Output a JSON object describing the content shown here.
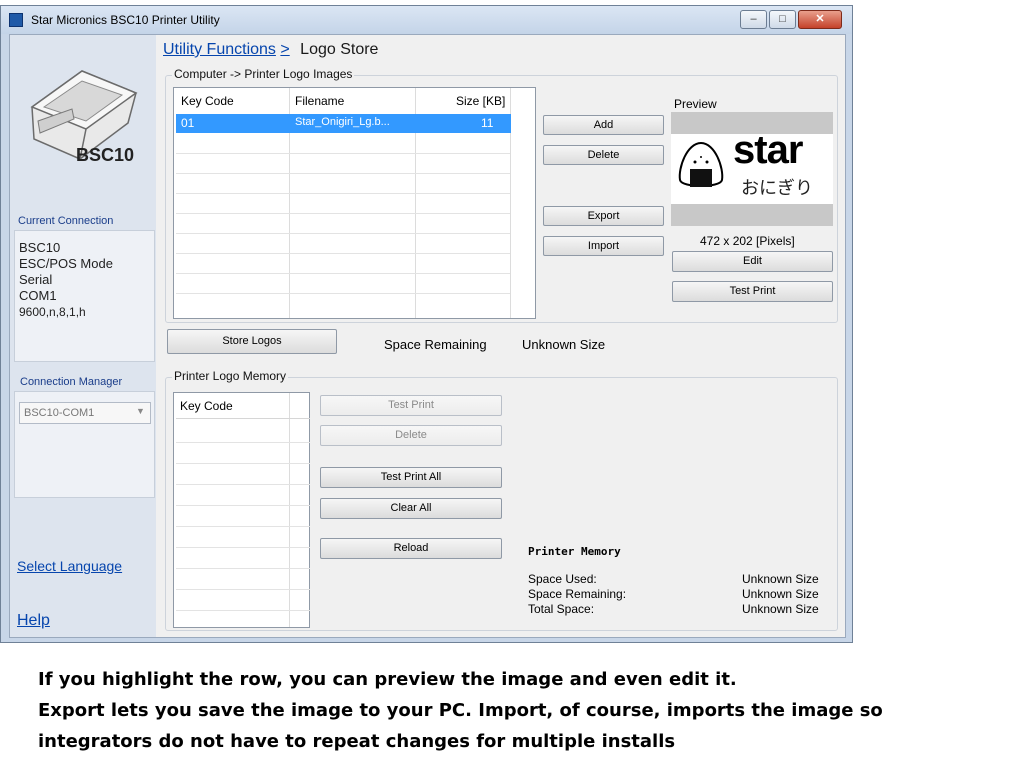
{
  "window": {
    "title": "Star Micronics BSC10 Printer Utility",
    "controls": [
      "–",
      "□",
      "✕"
    ]
  },
  "sidebar": {
    "printer_model": "BSC10",
    "current_connection_label": "Current Connection",
    "connection_lines": [
      "BSC10",
      "ESC/POS Mode",
      "Serial",
      "COM1",
      "9600,n,8,1,h"
    ],
    "connection_manager_label": "Connection Manager",
    "connection_selected": "BSC10-COM1",
    "select_language": "Select Language",
    "help": "Help"
  },
  "breadcrumb": {
    "parent": "Utility Functions",
    "separator": ">",
    "current": "Logo Store"
  },
  "computer_to_printer": {
    "group_title": "Computer -> Printer Logo Images",
    "columns": [
      "Key Code",
      "Filename",
      "Size [KB]"
    ],
    "rows": [
      {
        "key_code": "01",
        "filename": "Star_Onigiri_Lg.b...",
        "size": "11"
      }
    ],
    "buttons": {
      "add": "Add",
      "delete": "Delete",
      "export": "Export",
      "import": "Import"
    },
    "preview_label": "Preview",
    "preview_brand": "star",
    "preview_jp_text": "おにぎり",
    "preview_dimensions": "472 x 202 [Pixels]",
    "edit": "Edit",
    "test_print": "Test Print"
  },
  "store": {
    "store_logos": "Store Logos",
    "space_remaining_label": "Space Remaining",
    "space_remaining_value": "Unknown Size"
  },
  "printer_memory_group": {
    "group_title": "Printer Logo Memory",
    "column": "Key Code",
    "buttons": {
      "test_print": "Test Print",
      "delete": "Delete",
      "test_print_all": "Test Print All",
      "clear_all": "Clear All",
      "reload": "Reload"
    },
    "memory_title": "Printer Memory",
    "space_used_label": "Space Used:",
    "space_used_value": "Unknown Size",
    "space_remaining_label": "Space Remaining:",
    "space_remaining_value": "Unknown Size",
    "total_space_label": "Total Space:",
    "total_space_value": "Unknown Size"
  },
  "caption": {
    "line1": "If you highlight the row, you can preview the image and even edit it.",
    "line2": "Export lets you save the image to your PC. Import, of course, imports the image so",
    "line3": "integrators do not have to repeat changes for multiple installs"
  },
  "colors": {
    "selection": "#3399ff",
    "link": "#0645ad",
    "sidebar_bg": "#dde4ee"
  }
}
